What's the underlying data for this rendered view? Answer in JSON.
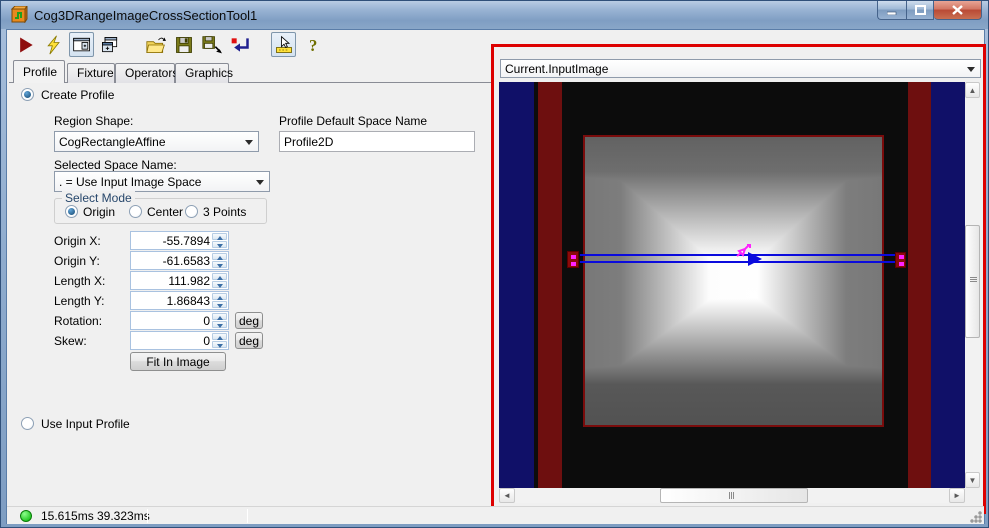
{
  "window": {
    "title": "Cog3DRangeImageCrossSectionTool1"
  },
  "toolbar": {
    "icons": [
      "run-icon",
      "run-electric-icon",
      "show-image-pane-icon",
      "float-pane-icon",
      "open-icon",
      "save-icon",
      "save-as-icon",
      "reset-icon",
      "graphics-interaction-icon",
      "help-icon"
    ]
  },
  "tabs": [
    {
      "label": "Profile",
      "selected": true
    },
    {
      "label": "Fixture",
      "selected": false
    },
    {
      "label": "Operators",
      "selected": false
    },
    {
      "label": "Graphics",
      "selected": false
    }
  ],
  "profile_tab": {
    "create_profile_label": "Create Profile",
    "region_shape_label": "Region Shape:",
    "region_shape_value": "CogRectangleAffine",
    "default_space_label": "Profile Default Space Name",
    "default_space_value": "Profile2D",
    "selected_space_label": "Selected Space Name:",
    "selected_space_value": ". = Use Input Image Space",
    "select_mode": {
      "label": "Select Mode",
      "options": [
        "Origin",
        "Center",
        "3 Points"
      ],
      "selected": "Origin"
    },
    "fields": [
      {
        "label": "Origin X:",
        "value": "-55.7894"
      },
      {
        "label": "Origin Y:",
        "value": "-61.6583"
      },
      {
        "label": "Length X:",
        "value": "111.982"
      },
      {
        "label": "Length Y:",
        "value": "1.86843"
      },
      {
        "label": "Rotation:",
        "value": "0",
        "unit": "deg"
      },
      {
        "label": "Skew:",
        "value": "0",
        "unit": "deg"
      }
    ],
    "fit_button_label": "Fit In Image",
    "use_input_profile_label": "Use Input Profile"
  },
  "display": {
    "source_selector_value": "Current.InputImage"
  },
  "status_bar": {
    "time1": "15.615ms",
    "time2": "39.323ms"
  },
  "colors": {
    "annotation_border": "#dd0000",
    "navy_bar": "#101068",
    "dark_red_bar": "#6e0f0f",
    "region_line_blue": "#0b0bdd",
    "handle_magenta": "#ff22ff",
    "status_green": "#00b400"
  }
}
